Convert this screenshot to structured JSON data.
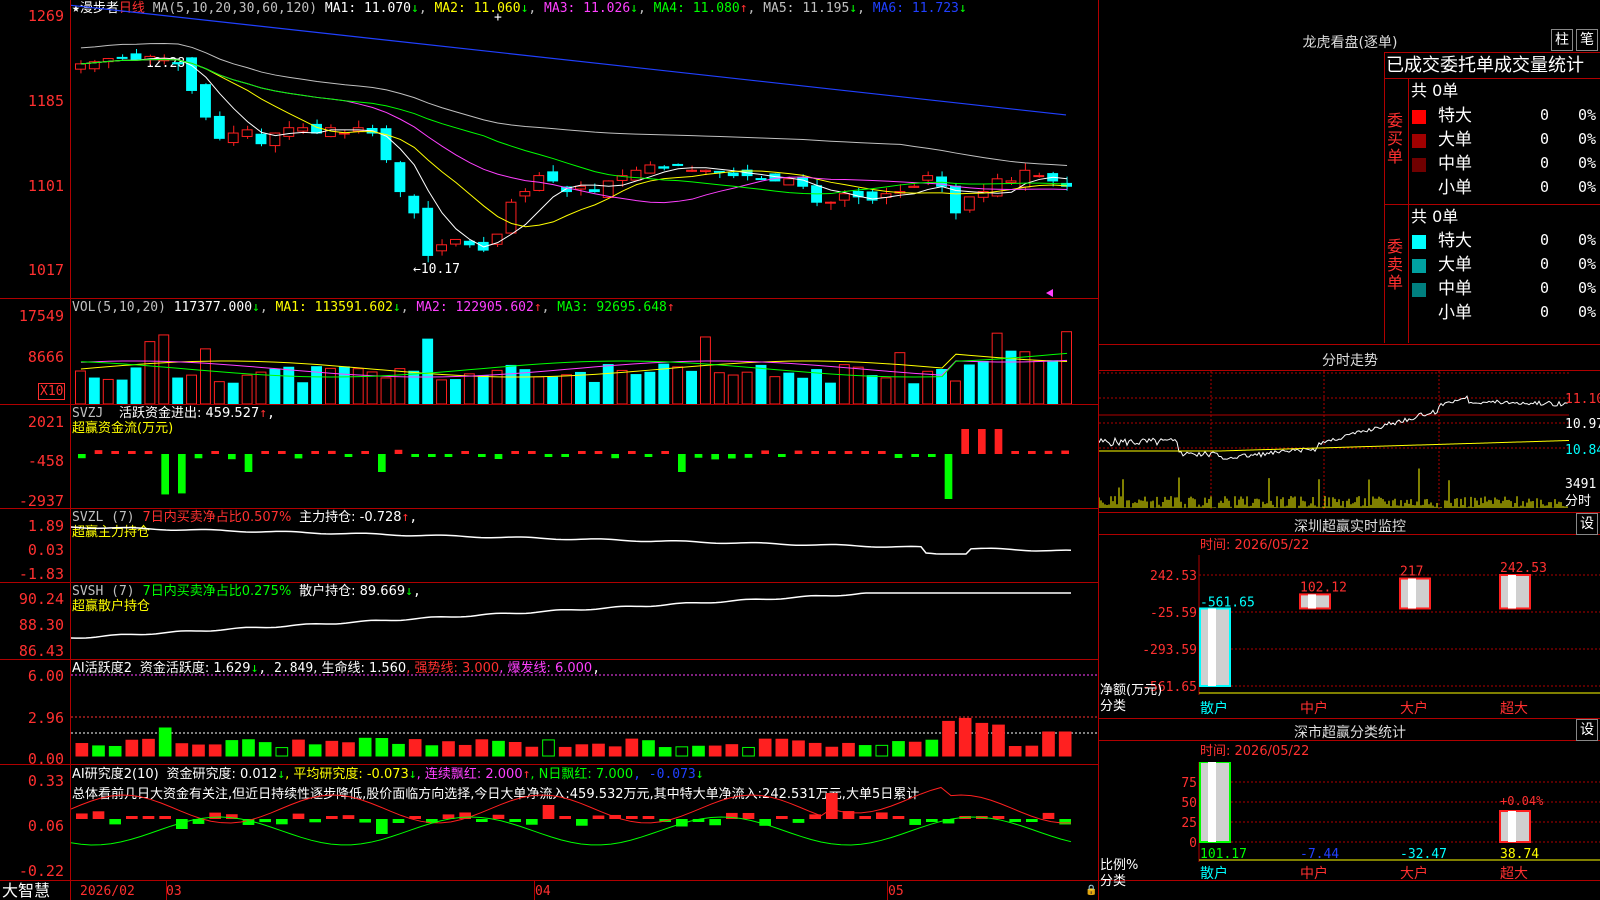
{
  "main": {
    "star": "★",
    "stock_name": "漫步者",
    "period": "日线",
    "ma_label": "MA(5,10,20,30,60,120)",
    "ma": [
      {
        "label": "MA1: 11.070",
        "arrow": "↓",
        "color": "#ffffff"
      },
      {
        "label": "MA2: 11.060",
        "arrow": "↓",
        "color": "#ffff00"
      },
      {
        "label": "MA3: 11.026",
        "arrow": "↓",
        "color": "#ff40ff"
      },
      {
        "label": "MA4: 11.080",
        "arrow": "↑",
        "color": "#00ff00"
      },
      {
        "label": "MA5: 11.195",
        "arrow": "↓",
        "color": "#c0c0c0"
      },
      {
        "label": "MA6: 11.723",
        "arrow": "↓",
        "color": "#2040ff"
      }
    ],
    "y_ticks": [
      "1269",
      "1185",
      "1101",
      "1017"
    ],
    "high_label": "12.28",
    "low_label": "←10.17"
  },
  "vol": {
    "label": "VOL(5,10,20)",
    "value": "117377.000",
    "arrow": "↓",
    "ma": [
      {
        "label": "MA1: 113591.602",
        "arrow": "↓",
        "color": "#ffff00"
      },
      {
        "label": "MA2: 122905.602",
        "arrow": "↑",
        "color": "#ff40ff"
      },
      {
        "label": "MA3: 92695.648",
        "arrow": "↑",
        "color": "#00ff00"
      }
    ],
    "y_ticks": [
      "17549",
      "8666"
    ],
    "unit": "X10"
  },
  "svzj": {
    "label": "SVZJ",
    "active_label": "活跃资金进出: 459.527",
    "arrow": "↑",
    "comma": ",",
    "sub": "超赢资金流(万元)",
    "y_ticks": [
      "2021",
      "-458",
      "-2937"
    ]
  },
  "svzl": {
    "label": "SVZL (7)",
    "ratio": "7日内买卖净占比0.507%",
    "main_pos": "主力持仓: -0.728",
    "arrow": "↑",
    "comma": ",",
    "sub": "超赢主力持仓",
    "y_ticks": [
      "1.89",
      "0.03",
      "-1.83"
    ]
  },
  "svsh": {
    "label": "SVSH (7)",
    "ratio": "7日内买卖净占比0.275%",
    "retail_pos": "散户持仓: 89.669",
    "arrow": "↓",
    "comma": ",",
    "sub": "超赢散户持仓",
    "y_ticks": [
      "90.24",
      "88.30",
      "86.43"
    ]
  },
  "ai1": {
    "label": "AI活跃度2",
    "p1": "资金活跃度: 1.629",
    "a1": "↓",
    "p2": ", 2.849",
    "p3": ", 生命线: 1.560",
    "p4": ", 强势线: 3.000",
    "p5": ", 爆发线: 6.000",
    "p6": ",",
    "y_ticks": [
      "6.00",
      "2.96",
      "0.00"
    ]
  },
  "ai2": {
    "label": "AI研究度2(10)",
    "p1": "资金研究度: 0.012",
    "a1": "↓",
    "p2": ", 平均研究度: -0.073",
    "a2": "↓",
    "p3": ", 连续飘红: 2.000",
    "a3": "↑",
    "p4": ", N日飘红: 7.000",
    "p5": ", -0.073",
    "a5": "↓",
    "summary": "总体看前几日大资金有关注,但近日持续性逐步降低,股价面临方向选择,今日大单净流入:459.532万元,其中特大单净流入:242.531万元,大单5日累计",
    "y_ticks": [
      "0.33",
      "0.06",
      "-0.22"
    ]
  },
  "xaxis": {
    "logo": "大智慧",
    "labels": [
      "2026/02",
      "03",
      "04",
      "05"
    ]
  },
  "right": {
    "lhb": {
      "title": "龙虎看盘(逐单)",
      "btn1": "柱",
      "btn2": "笔",
      "header": "已成交委托单成交量统计",
      "buy": {
        "side_label": "委买单",
        "total": "共 0单",
        "rows": [
          {
            "name": "特大",
            "count": "0",
            "pct": "0%",
            "color": "#ff0000"
          },
          {
            "name": "大单",
            "count": "0",
            "pct": "0%",
            "color": "#a00000"
          },
          {
            "name": "中单",
            "count": "0",
            "pct": "0%",
            "color": "#700000"
          },
          {
            "name": "小单",
            "count": "0",
            "pct": "0%",
            "color": "#000000"
          }
        ]
      },
      "sell": {
        "side_label": "委卖单",
        "total": "共 0单",
        "rows": [
          {
            "name": "特大",
            "count": "0",
            "pct": "0%",
            "color": "#00ffff"
          },
          {
            "name": "大单",
            "count": "0",
            "pct": "0%",
            "color": "#00a0a0"
          },
          {
            "name": "中单",
            "count": "0",
            "pct": "0%",
            "color": "#008080"
          },
          {
            "name": "小单",
            "count": "0",
            "pct": "0%",
            "color": "#000000"
          }
        ]
      }
    },
    "intraday": {
      "title": "分时走势",
      "prices": [
        "11.10",
        "10.97",
        "10.84"
      ],
      "vol": "3491",
      "vol_unit": "分时"
    },
    "monitor": {
      "title": "深圳超赢实时监控",
      "btn": "设",
      "time": "时间: 2026/05/22",
      "y_ticks": [
        "242.53",
        "-25.59",
        "-293.59",
        "-561.65"
      ],
      "ylabel1": "净额(万元)",
      "ylabel2": "分类",
      "cats": [
        "散户",
        "中户",
        "大户",
        "超大"
      ],
      "values": [
        -561.65,
        102.12,
        217,
        242.53
      ],
      "value_labels": [
        "-561.65",
        "102.12",
        "217",
        "242.53"
      ],
      "ylim": [
        -561.65,
        242.53
      ]
    },
    "classify": {
      "title": "深市超赢分类统计",
      "btn": "设",
      "time": "时间: 2026/05/22",
      "y_ticks": [
        "75",
        "50",
        "25",
        "0"
      ],
      "ylabel1": "比例%",
      "ylabel2": "分类",
      "cats": [
        "散户",
        "中户",
        "大户",
        "超大"
      ],
      "values": [
        101.17,
        -7.44,
        -32.47,
        38.74
      ],
      "value_labels": [
        "101.17",
        "-7.44",
        "-32.47",
        "38.74"
      ],
      "extra": "+0.04%"
    }
  },
  "colors": {
    "up": "#ff2020",
    "down": "#00ffff",
    "grid": "#b00000"
  }
}
